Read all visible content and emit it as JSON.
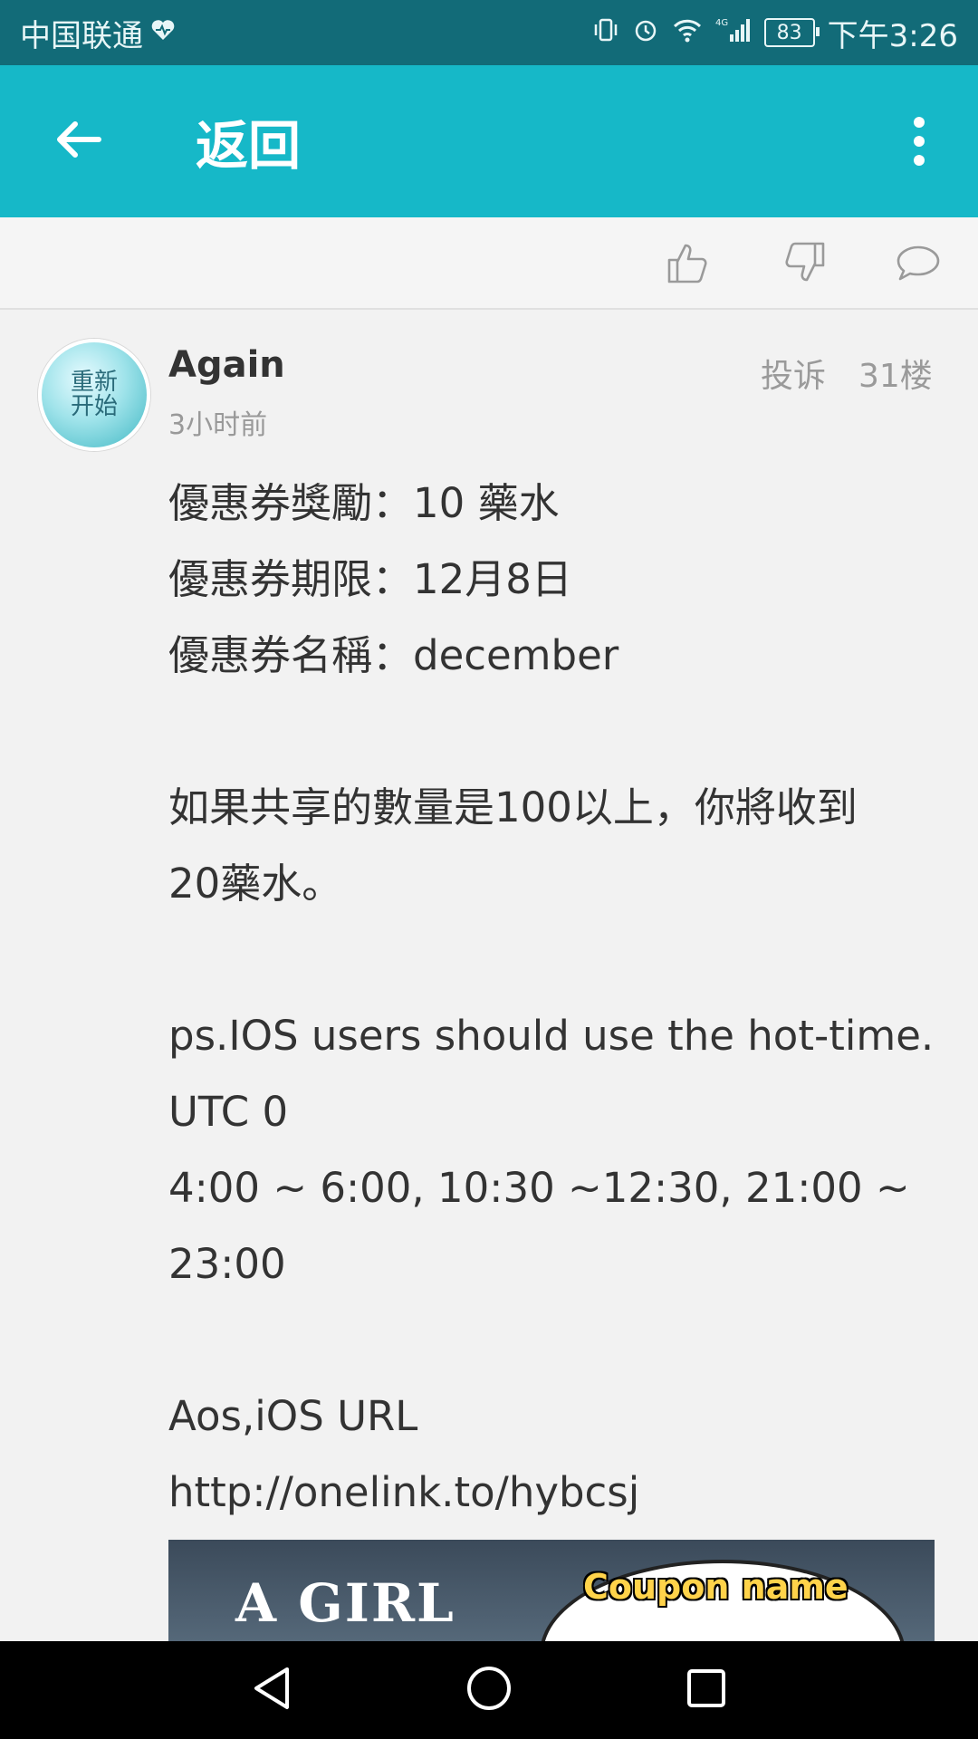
{
  "status_bar": {
    "carrier": "中国联通",
    "battery": "83",
    "time": "下午3:26"
  },
  "app_bar": {
    "title": "返回"
  },
  "post": {
    "username": "Again",
    "time": "3小时前",
    "report": "投诉",
    "floor": "31楼",
    "avatar_text": "重新\n开始",
    "lines": [
      "優惠券獎勵：10 藥水",
      "優惠券期限：12月8日",
      "優惠券名稱：december",
      "",
      "如果共享的數量是100以上，你將收到",
      "20藥水。",
      "",
      "ps.IOS users should use the hot-time.",
      "UTC 0",
      "4:00 ~ 6:00, 10:30 ~12:30, 21:00 ~",
      "23:00",
      "",
      "Aos,iOS URL",
      "http://onelink.to/hybcsj"
    ],
    "image": {
      "title": "A GIRL",
      "coupon_label": "Coupon name"
    }
  },
  "icons": {
    "back": "arrow-left-icon",
    "more": "more-vert-icon",
    "like": "thumbs-up-icon",
    "dislike": "thumbs-down-icon",
    "comment": "comment-icon"
  },
  "colors": {
    "status_bar": "#126b78",
    "app_bar": "#16b8c8",
    "background": "#f2f2f2"
  }
}
